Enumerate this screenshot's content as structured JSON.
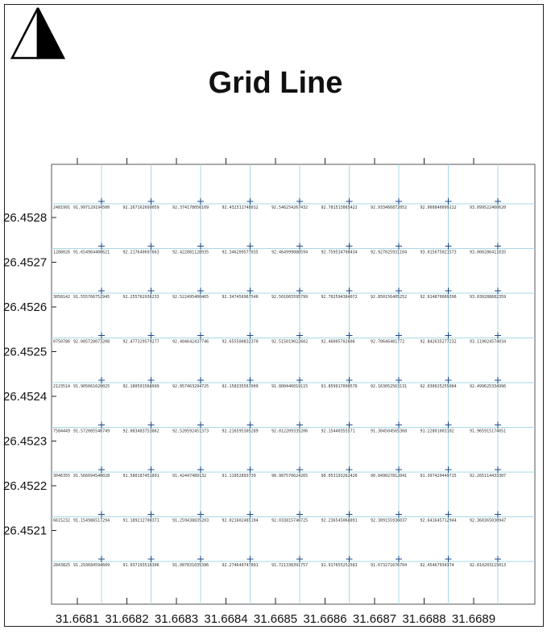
{
  "title": "Grid Line",
  "north_arrow": {
    "icon": "north-arrow-icon"
  },
  "colors": {
    "grid_line": "#a9d8e6",
    "marker": "#1a4a8a",
    "frame": "#222222"
  },
  "x_ticks": [
    "31.6681",
    "31.6682",
    "31.6683",
    "31.6684",
    "31.6685",
    "31.6686",
    "31.6687",
    "31.6688",
    "31.6689"
  ],
  "y_ticks": [
    "26.4528",
    "26.4527",
    "26.4526",
    "26.4525",
    "26.4524",
    "26.4523",
    "26.4522",
    "26.4521"
  ],
  "point_rows": [
    [
      "2481991",
      "91.997129194500",
      "92.267162699059",
      "92.374178056109",
      "92.432311748012",
      "92.546254267432",
      "92.781513065422",
      "92.933466872052",
      "92.960840099112",
      "93.099522460620"
    ],
    [
      "1288026",
      "91.654964400621",
      "92.217640697663",
      "92.422081128935",
      "92.346209577035",
      "92.464999080594",
      "92.759534700434",
      "92.927025931104",
      "93.015675021573",
      "93.000286411035"
    ],
    [
      "3058142",
      "91.555766752945",
      "92.255762936233",
      "92.522495400465",
      "92.347456967546",
      "92.501065595799",
      "92.702594384072",
      "92.850156405252",
      "92.914870009396",
      "93.030288682359"
    ],
    [
      "0750786",
      "92.005720073208",
      "92.477329579277",
      "92.404642437746",
      "92.655500832370",
      "92.515019022602",
      "92.46005702606",
      "92.70646481772",
      "92.842635277232",
      "93.119024574034"
    ],
    [
      "2123514",
      "91.905061620025",
      "92.180501568999",
      "92.057463294725",
      "92.158335567009",
      "91.800446019115",
      "91.859917090576",
      "92.163052563131",
      "92.030025255084",
      "92.499625334996"
    ],
    [
      "7584449",
      "91.572085546749",
      "92.083483753862",
      "92.520592451373",
      "92.216595305289",
      "92.012209335206",
      "92.15440355571",
      "91.304504565368",
      "91.22801003102",
      "91.965915174051"
    ],
    [
      "3046355",
      "91.566094540028",
      "91.580187451891",
      "91.42447489132",
      "91.11952893739",
      "90.987570624265",
      "90.053193262426",
      "90.849027812041",
      "91.397429449715",
      "92.265114433307"
    ],
    [
      "6615232",
      "91.154986517294",
      "91.189212700371",
      "91.259438835203",
      "92.021602485104",
      "92.033815740725",
      "92.236545068891",
      "92.309155936037",
      "92.641645712944",
      "92.360365030947"
    ],
    [
      "2843825",
      "91.293684594609",
      "91.037193516306",
      "91.087831035396",
      "92.274640747891",
      "91.721338391757",
      "91.917655252581",
      "91.673271676704",
      "92.45467934374",
      "92.810203115013"
    ]
  ]
}
